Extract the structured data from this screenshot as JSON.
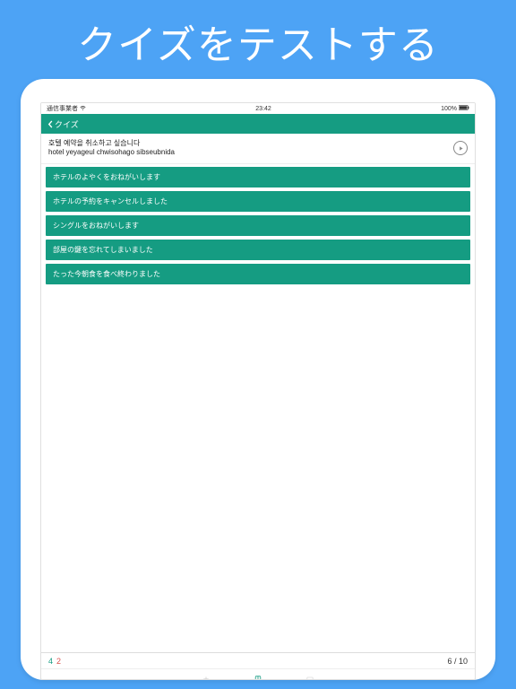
{
  "banner": "クイズをテストする",
  "status": {
    "carrier": "通信事業者",
    "time": "23:42",
    "battery": "100%"
  },
  "nav": {
    "back_label": "クイズ"
  },
  "question": {
    "line1": "호텔 예약을 취소하고 싶습니다",
    "line2": "hotel yeyageul chwisohago sibseubnida"
  },
  "answers": [
    "ホテルのよやくをおねがいします",
    "ホテルの予約をキャンセルしました",
    "シングルをおねがいします",
    "部屋の鍵を忘れてしまいました",
    "たった今朝食を食べ終わりました"
  ],
  "footer": {
    "correct": "4",
    "wrong": "2",
    "progress": "6 / 10"
  }
}
